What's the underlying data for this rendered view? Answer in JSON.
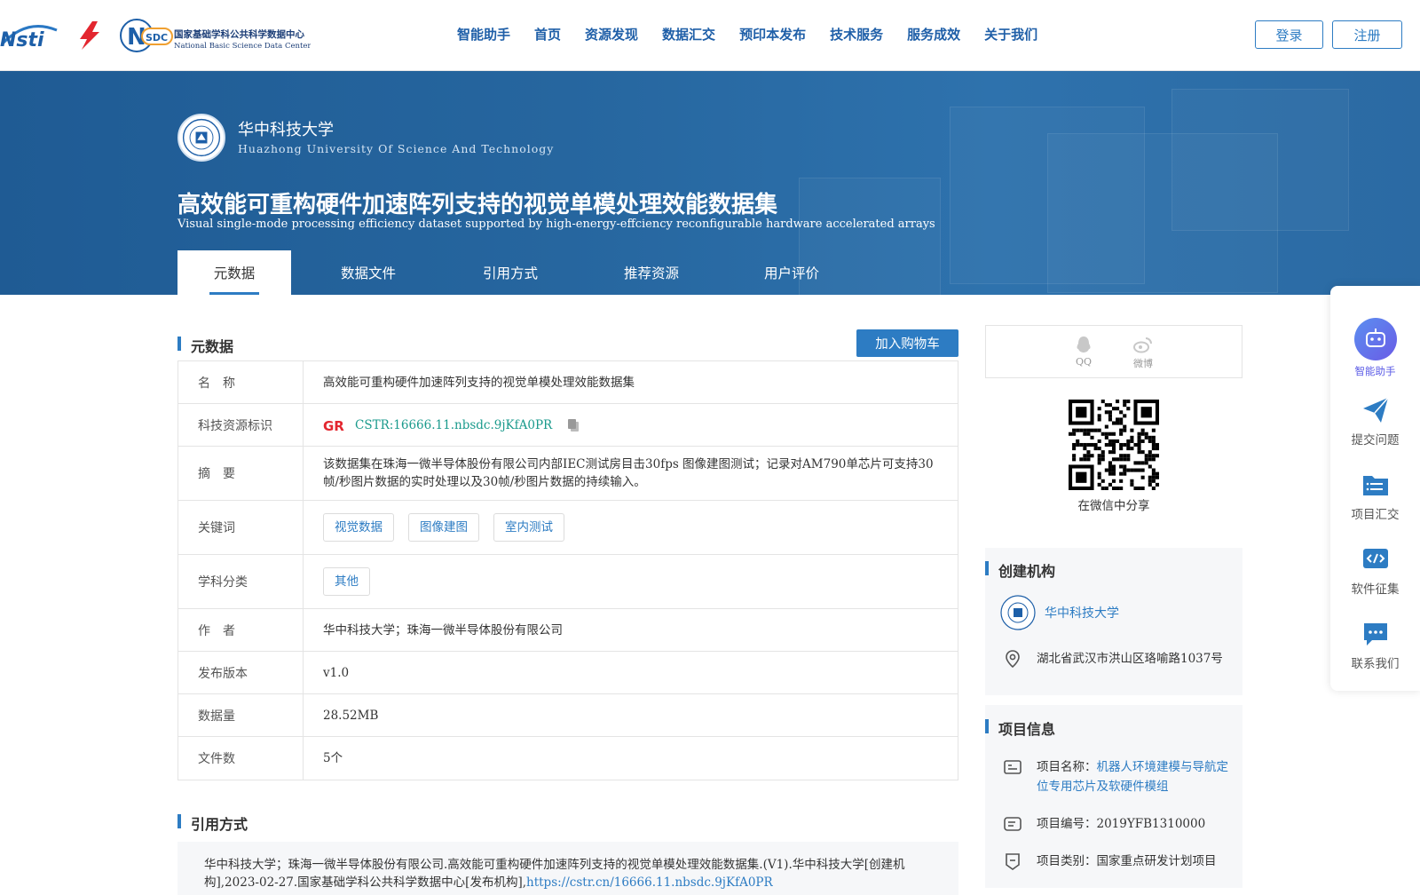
{
  "header": {
    "nav": [
      "智能助手",
      "首页",
      "资源发现",
      "数据汇交",
      "预印本发布",
      "技术服务",
      "服务成效",
      "关于我们"
    ],
    "login_label": "登录",
    "register_label": "注册",
    "logo_nsti": "Nsti",
    "logo_nsdc_cn": "国家基础学科公共科学数据中心",
    "logo_nsdc_en": "National Basic Science Data Center",
    "logo_nsdc_abbr": "SDC"
  },
  "hero": {
    "univ_name": "华中科技大学",
    "univ_en": "Huazhong University Of Science And Technology",
    "title_cn": "高效能可重构硬件加速阵列支持的视觉单模处理效能数据集",
    "title_en": "Visual single-mode processing efficiency dataset supported by high-energy-effciency reconfigurable hardware accelerated arrays",
    "tabs": [
      "元数据",
      "数据文件",
      "引用方式",
      "推荐资源",
      "用户评价"
    ]
  },
  "metadata": {
    "section_title": "元数据",
    "cart_label": "加入购物车",
    "rows": {
      "name": {
        "k": "名　称",
        "v": "高效能可重构硬件加速阵列支持的视觉单模处理效能数据集"
      },
      "cstr": {
        "k": "科技资源标识",
        "v": "CSTR:16666.11.nbsdc.9jKfA0PR"
      },
      "abstract": {
        "k": "摘　要",
        "v": "该数据集在珠海一微半导体股份有限公司内部IEC测试房目击30fps 图像建图测试；记录对AM790单芯片可支持30帧/秒图片数据的实时处理以及30帧/秒图片数据的持续输入。"
      },
      "keywords": {
        "k": "关键词",
        "v": [
          "视觉数据",
          "图像建图",
          "室内测试"
        ]
      },
      "subject": {
        "k": "学科分类",
        "v": [
          "其他"
        ]
      },
      "author": {
        "k": "作　者",
        "v": "华中科技大学；珠海一微半导体股份有限公司"
      },
      "version": {
        "k": "发布版本",
        "v": "v1.0"
      },
      "size": {
        "k": "数据量",
        "v": "28.52MB"
      },
      "files": {
        "k": "文件数",
        "v": "5个"
      }
    }
  },
  "citation": {
    "section_title": "引用方式",
    "text": "华中科技大学；珠海一微半导体股份有限公司.高效能可重构硬件加速阵列支持的视觉单模处理效能数据集.(V1).华中科技大学[创建机构],2023-02-27.国家基础学科公共科学数据中心[发布机构],",
    "link": "https://cstr.cn/16666.11.nbsdc.9jKfA0PR"
  },
  "share": {
    "qq": "QQ",
    "weibo": "微博",
    "wechat_caption": "在微信中分享"
  },
  "creator": {
    "section_title": "创建机构",
    "name": "华中科技大学",
    "address": "湖北省武汉市洪山区珞喻路1037号"
  },
  "project": {
    "section_title": "项目信息",
    "name_label": "项目名称：",
    "name_value": "机器人环境建模与导航定位专用芯片及软硬件模组",
    "code_label": "项目编号：",
    "code_value": "2019YFB1310000",
    "type_label": "项目类别：",
    "type_value": "国家重点研发计划项目"
  },
  "floatbar": [
    "智能助手",
    "提交问题",
    "项目汇交",
    "软件征集",
    "联系我们"
  ],
  "colors": {
    "primary": "#2d7cc3",
    "hero": "#26669f",
    "cstr": "#1a9a8c"
  }
}
